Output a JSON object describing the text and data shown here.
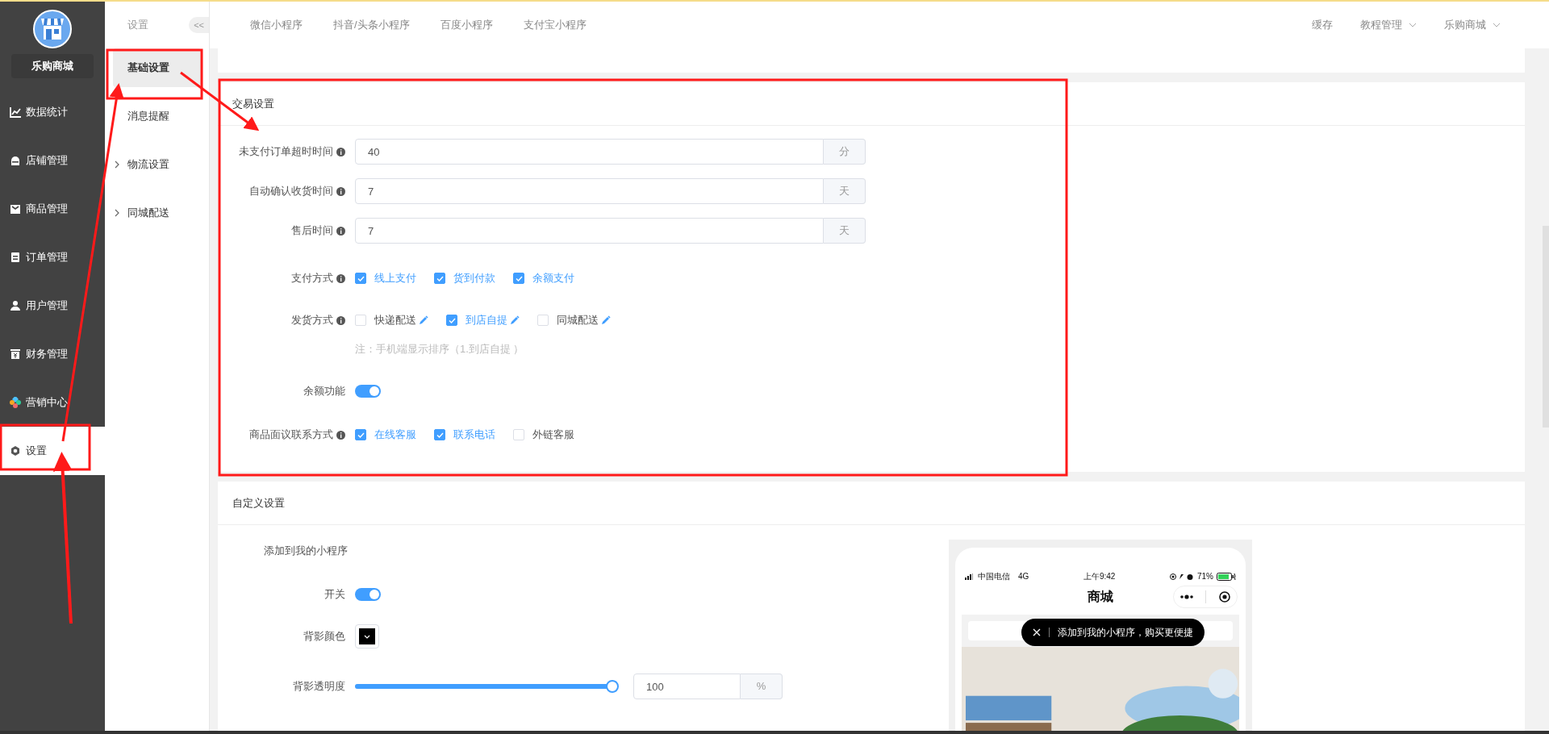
{
  "sidebar": {
    "store_name": "乐购商城",
    "items": [
      {
        "label": "数据统计",
        "selected": false
      },
      {
        "label": "店铺管理",
        "selected": false
      },
      {
        "label": "商品管理",
        "selected": false
      },
      {
        "label": "订单管理",
        "selected": false
      },
      {
        "label": "用户管理",
        "selected": false
      },
      {
        "label": "财务管理",
        "selected": false
      },
      {
        "label": "营销中心",
        "selected": false
      },
      {
        "label": "设置",
        "selected": true
      }
    ]
  },
  "subnav": {
    "title": "设置",
    "collapse": "<<",
    "items": [
      {
        "label": "基础设置",
        "selected": true,
        "expandable": false
      },
      {
        "label": "消息提醒",
        "selected": false,
        "expandable": false
      },
      {
        "label": "物流设置",
        "selected": false,
        "expandable": true
      },
      {
        "label": "同城配送",
        "selected": false,
        "expandable": true
      }
    ]
  },
  "topbar": {
    "tabs": [
      "微信小程序",
      "抖音/头条小程序",
      "百度小程序",
      "支付宝小程序"
    ],
    "right": [
      {
        "label": "缓存",
        "dropdown": false
      },
      {
        "label": "教程管理",
        "dropdown": true
      },
      {
        "label": "乐购商城",
        "dropdown": true
      }
    ]
  },
  "trade_settings": {
    "title": "交易设置",
    "rows": [
      {
        "kind": "input",
        "label": "未支付订单超时时间",
        "info": true,
        "value": "40",
        "unit": "分"
      },
      {
        "kind": "input",
        "label": "自动确认收货时间",
        "info": true,
        "value": "7",
        "unit": "天"
      },
      {
        "kind": "input",
        "label": "售后时间",
        "info": true,
        "value": "7",
        "unit": "天"
      },
      {
        "kind": "checkboxes",
        "label": "支付方式",
        "info": true,
        "options": [
          {
            "label": "线上支付",
            "checked": true,
            "editable": false
          },
          {
            "label": "货到付款",
            "checked": true,
            "editable": false
          },
          {
            "label": "余额支付",
            "checked": true,
            "editable": false
          }
        ]
      },
      {
        "kind": "checkboxes",
        "label": "发货方式",
        "info": true,
        "options": [
          {
            "label": "快递配送",
            "checked": false,
            "editable": true
          },
          {
            "label": "到店自提",
            "checked": true,
            "editable": true
          },
          {
            "label": "同城配送",
            "checked": false,
            "editable": true
          }
        ]
      },
      {
        "kind": "note",
        "text": "注：手机端显示排序（1.到店自提 ）"
      },
      {
        "kind": "toggle",
        "label": "余额功能",
        "info": false,
        "on": true
      },
      {
        "kind": "checkboxes",
        "label": "商品面议联系方式",
        "info": true,
        "options": [
          {
            "label": "在线客服",
            "checked": true,
            "editable": false
          },
          {
            "label": "联系电话",
            "checked": true,
            "editable": false
          },
          {
            "label": "外链客服",
            "checked": false,
            "editable": false
          }
        ]
      }
    ]
  },
  "custom_settings": {
    "title": "自定义设置",
    "subtitle": "添加到我的小程序",
    "rows": [
      {
        "kind": "toggle",
        "label": "开关",
        "on": true
      },
      {
        "kind": "color",
        "label": "背影颜色",
        "color": "#000000"
      },
      {
        "kind": "slider",
        "label": "背影透明度",
        "level": 1.0,
        "value": "100",
        "unit": "%"
      }
    ],
    "preview": {
      "carrier": "中国电信",
      "network": "4G",
      "time": "上午9:42",
      "battery": "71%",
      "title": "商城",
      "tip": "添加到我的小程序，购买更便捷"
    }
  }
}
